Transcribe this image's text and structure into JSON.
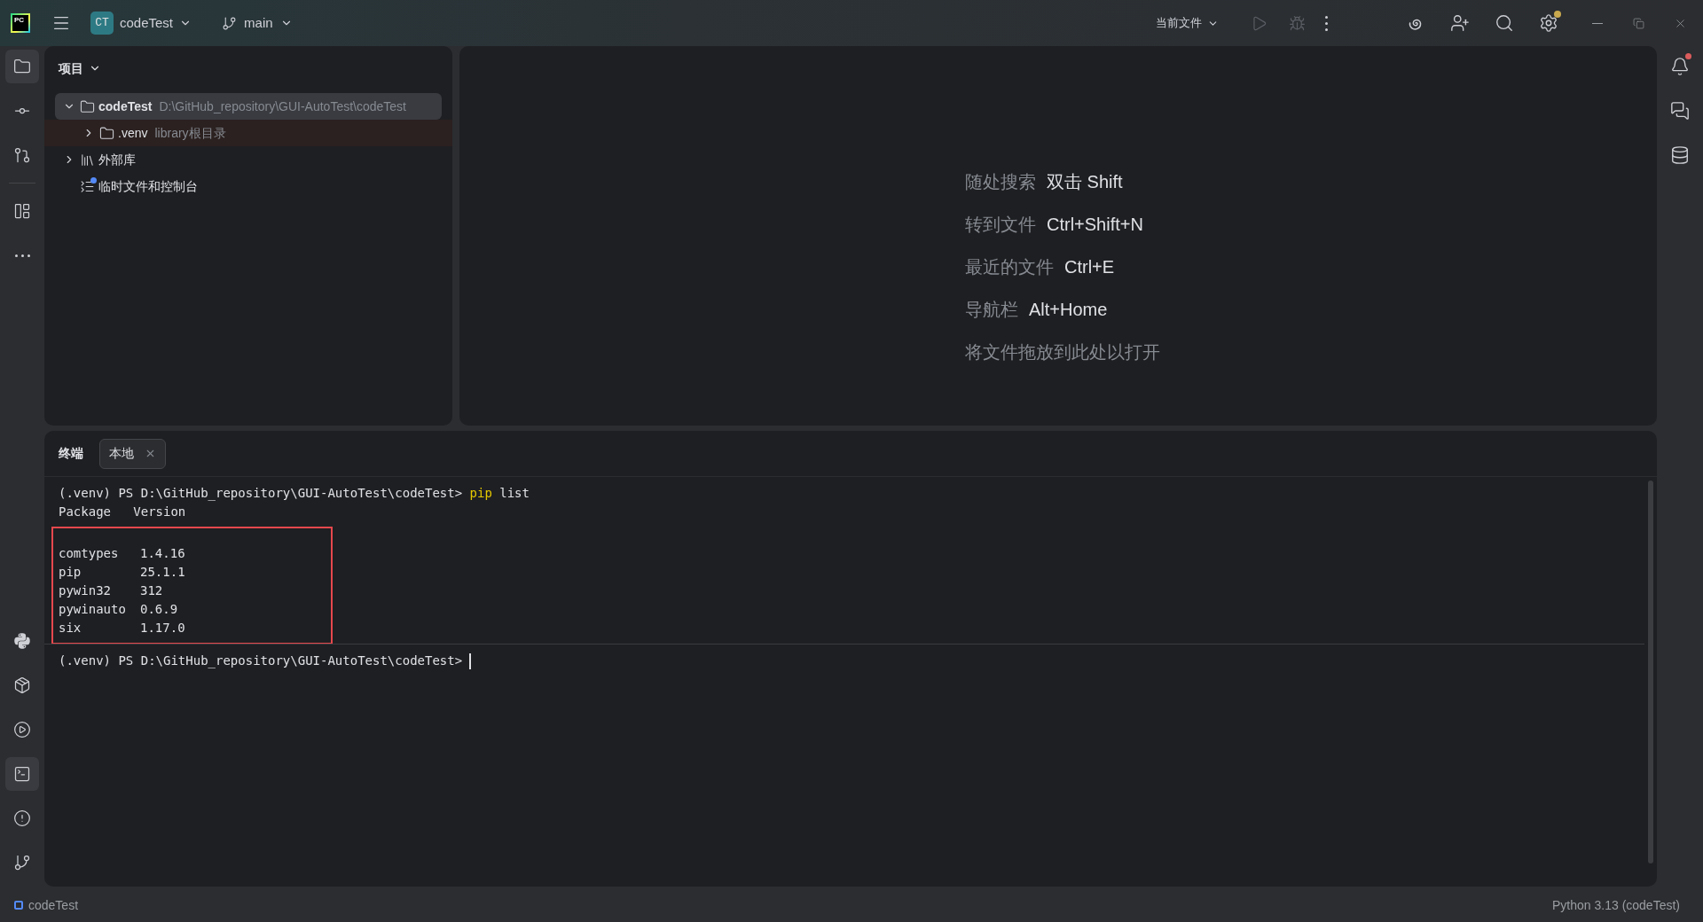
{
  "title_bar": {
    "logo": "PC",
    "project_badge": "CT",
    "project": "codeTest",
    "branch": "main",
    "run_config": "当前文件"
  },
  "left_tools_top": [
    {
      "kind": "project",
      "selected": true
    },
    {
      "kind": "commit",
      "selected": false
    },
    {
      "kind": "pull-requests",
      "selected": false
    },
    {
      "kind": "structure",
      "selected": false
    },
    {
      "kind": "more",
      "selected": false
    }
  ],
  "left_tools_bottom": [
    {
      "kind": "python-console",
      "selected": false
    },
    {
      "kind": "python-packages",
      "selected": false
    },
    {
      "kind": "services",
      "selected": false
    },
    {
      "kind": "terminal",
      "selected": true
    },
    {
      "kind": "problems",
      "selected": false
    },
    {
      "kind": "git",
      "selected": false
    }
  ],
  "project_panel": {
    "title": "项目",
    "tree": [
      {
        "kind": "folder",
        "name": "codeTest",
        "note": "D:\\GitHub_repository\\GUI-AutoTest\\codeTest",
        "expanded": true,
        "selected": true,
        "highlighted": false,
        "children": [
          {
            "kind": "folder",
            "name": ".venv",
            "note": "library根目录",
            "expanded": false,
            "selected": false,
            "highlighted": true
          }
        ]
      },
      {
        "kind": "library",
        "name": "外部库",
        "expanded": false,
        "selected": false,
        "highlighted": false
      },
      {
        "kind": "scratch",
        "name": "临时文件和控制台",
        "selected": false,
        "highlighted": false
      }
    ]
  },
  "editor_hints": [
    {
      "label": "随处搜索",
      "shortcut": "双击 Shift"
    },
    {
      "label": "转到文件",
      "shortcut": "Ctrl+Shift+N"
    },
    {
      "label": "最近的文件",
      "shortcut": "Ctrl+E"
    },
    {
      "label": "导航栏",
      "shortcut": "Alt+Home"
    },
    {
      "label": "将文件拖放到此处以打开"
    }
  ],
  "terminal": {
    "title": "终端",
    "tabs": [
      {
        "label": "本地",
        "selected": true
      }
    ],
    "command": {
      "prompt": "(.venv) PS D:\\GitHub_repository\\GUI-AutoTest\\codeTest>",
      "program": "pip",
      "args": "list"
    },
    "header": "Package   Version",
    "packages": [
      {
        "name": "comtypes",
        "version": "1.4.16"
      },
      {
        "name": "pip",
        "version": "25.1.1"
      },
      {
        "name": "pywin32",
        "version": "312"
      },
      {
        "name": "pywinauto",
        "version": "0.6.9"
      },
      {
        "name": "six",
        "version": "1.17.0"
      }
    ],
    "prompt": "(.venv) PS D:\\GitHub_repository\\GUI-AutoTest\\codeTest>"
  },
  "right_tools": [
    {
      "kind": "notifications",
      "badge": true
    },
    {
      "kind": "ai-chat",
      "badge": false
    },
    {
      "kind": "database",
      "badge": false
    }
  ],
  "status_bar": {
    "project": "codeTest",
    "interpreter": "Python 3.13 (codeTest)"
  }
}
